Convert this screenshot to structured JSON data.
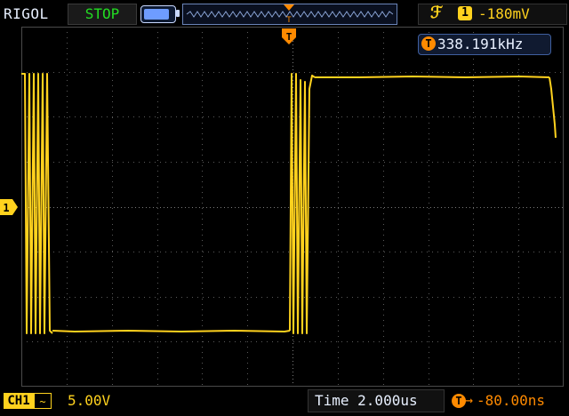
{
  "header": {
    "brand": "RIGOL",
    "run_state": "STOP",
    "trigger_edge_icon": "rising-edge-icon",
    "trigger_channel": "1",
    "trigger_level": "-180mV"
  },
  "measurement": {
    "marker": "T",
    "frequency": "338.191kHz"
  },
  "trigger_position_marker": "T",
  "channel_marker": "1",
  "footer": {
    "channel_label": "CH1",
    "coupling": "~",
    "volts_per_div": "5.00V",
    "timebase": "Time 2.000us",
    "delay_marker": "T",
    "delay_arrow": "→",
    "trigger_delay": "-80.00ns"
  },
  "colors": {
    "trace": "#ffd21e",
    "grid": "#5a5a5a",
    "trigger": "#ff8a00",
    "run_state": "#22dd22",
    "text": "#e8f0ff"
  }
}
